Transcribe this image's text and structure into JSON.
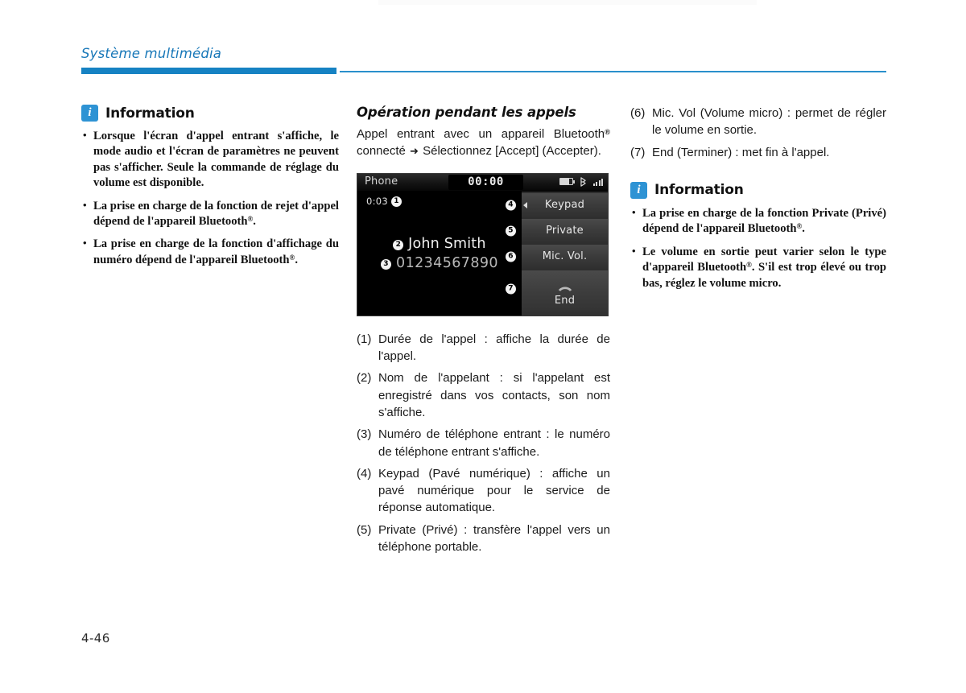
{
  "page": {
    "header_title": "Système multimédia",
    "page_number": "4-46",
    "accent_color": "#1682c3",
    "info_badge_color": "#2e93d4"
  },
  "left_column": {
    "info": {
      "icon": "info-icon",
      "icon_letter": "i",
      "title": "Information",
      "bullets": [
        "Lorsque l'écran d'appel entrant s'affiche, le mode audio et l'écran de paramètres ne peuvent pas s'afficher. Seule la commande de réglage du volume est disponible.",
        "La prise en charge de la fonction de rejet d'appel dépend de l'appareil Bluetooth®.",
        "La prise en charge de la fonction d'affichage du numéro dépend de l'appareil Bluetooth®."
      ]
    }
  },
  "middle_column": {
    "section_title": "Opération pendant les appels",
    "intro": "Appel entrant avec un appareil Bluetooth® connecté ➜ Sélectionnez [Accept] (Accepter).",
    "device": {
      "app_name": "Phone",
      "clock": "00:00",
      "status_icons": [
        "battery-icon",
        "bluetooth-phone-icon",
        "signal-icon"
      ],
      "call_duration": "0:03",
      "caller_name": "John Smith",
      "caller_number": "01234567890",
      "callout_duration": "1",
      "callout_name": "2",
      "callout_number": "3",
      "callout_keypad": "4",
      "callout_private": "5",
      "callout_micvol": "6",
      "callout_end": "7",
      "buttons": [
        {
          "label": "Keypad"
        },
        {
          "label": "Private"
        },
        {
          "label": "Mic. Vol."
        },
        {
          "label": "End"
        }
      ]
    },
    "numbered_items": [
      {
        "key": "(1)",
        "text": "Durée de l'appel : affiche la durée de l'appel."
      },
      {
        "key": "(2)",
        "text": "Nom de l'appelant : si l'appelant est enregistré dans vos contacts, son nom s'affiche."
      },
      {
        "key": "(3)",
        "text": "Numéro de téléphone entrant : le numéro de téléphone entrant s'affiche."
      },
      {
        "key": "(4)",
        "text": "Keypad (Pavé numérique) :  affiche un pavé numérique pour le service de réponse automatique."
      },
      {
        "key": "(5)",
        "text": "Private (Privé) : transfère l'appel vers un téléphone portable."
      }
    ]
  },
  "right_column": {
    "numbered_items": [
      {
        "key": "(6)",
        "text": "Mic. Vol (Volume micro) : permet de régler le volume en sortie."
      },
      {
        "key": "(7)",
        "text": "End (Terminer) : met fin à l'appel."
      }
    ],
    "info": {
      "icon": "info-icon",
      "icon_letter": "i",
      "title": "Information",
      "bullets": [
        "La prise en charge de la fonction Private (Privé) dépend de l'appareil Bluetooth®.",
        "Le volume en sortie peut varier selon le type d'appareil Bluetooth®. S'il est trop élevé ou trop bas, réglez le volume micro."
      ]
    }
  }
}
